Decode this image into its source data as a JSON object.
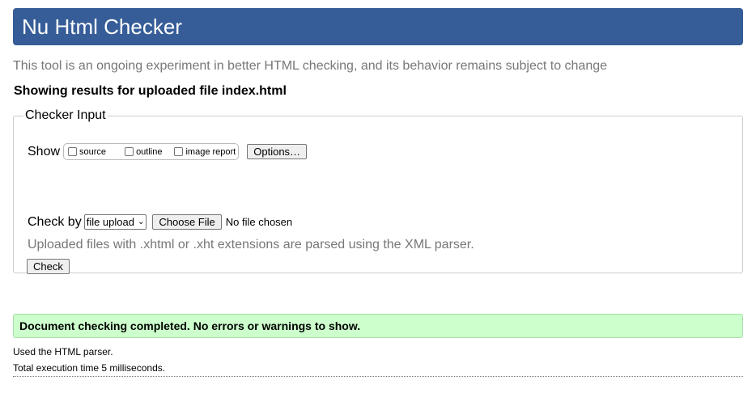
{
  "header": {
    "title": "Nu Html Checker"
  },
  "intro": "This tool is an ongoing experiment in better HTML checking, and its behavior remains subject to change",
  "showing_results": "Showing results for uploaded file index.html",
  "checker_input": {
    "legend": "Checker Input",
    "show_label": "Show",
    "checkboxes": [
      {
        "label": "source",
        "checked": false
      },
      {
        "label": "outline",
        "checked": false
      },
      {
        "label": "image report",
        "checked": false
      }
    ],
    "options_button": "Options…",
    "check_by_label": "Check by",
    "check_by_selected": "file upload",
    "choose_file_button": "Choose File",
    "no_file_text": "No file chosen",
    "hint": "Uploaded files with .xhtml or .xht extensions are parsed using the XML parser.",
    "check_button": "Check"
  },
  "result": {
    "message": "Document checking completed. No errors or warnings to show.",
    "parser_line": "Used the HTML parser.",
    "time_line": "Total execution time 5 milliseconds."
  }
}
